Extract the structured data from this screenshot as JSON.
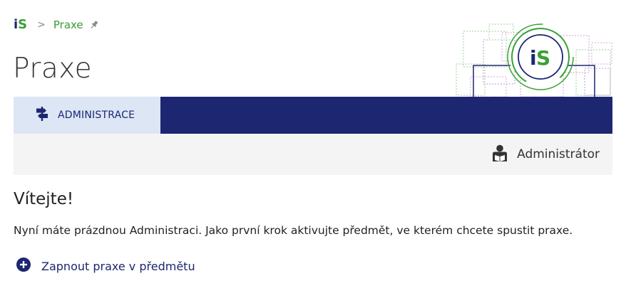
{
  "breadcrumb": {
    "logo_i": "i",
    "logo_s": "S",
    "separator": ">",
    "current": "Praxe"
  },
  "page": {
    "title": "Praxe"
  },
  "nav": {
    "tab_label": "ADMINISTRACE"
  },
  "role": {
    "label": "Administrátor"
  },
  "content": {
    "heading": "Vítejte!",
    "description": "Nyní máte prázdnou Administraci. Jako první krok aktivujte předmět, ve kterém chcete spustit praxe.",
    "action_label": "Zapnout praxe v předmětu"
  },
  "badge": {
    "i": "i",
    "s": "S"
  },
  "colors": {
    "navy": "#1d2671",
    "green": "#3aa035",
    "tab_bg": "#dce6f5",
    "rolebar_bg": "#f4f4f4"
  }
}
